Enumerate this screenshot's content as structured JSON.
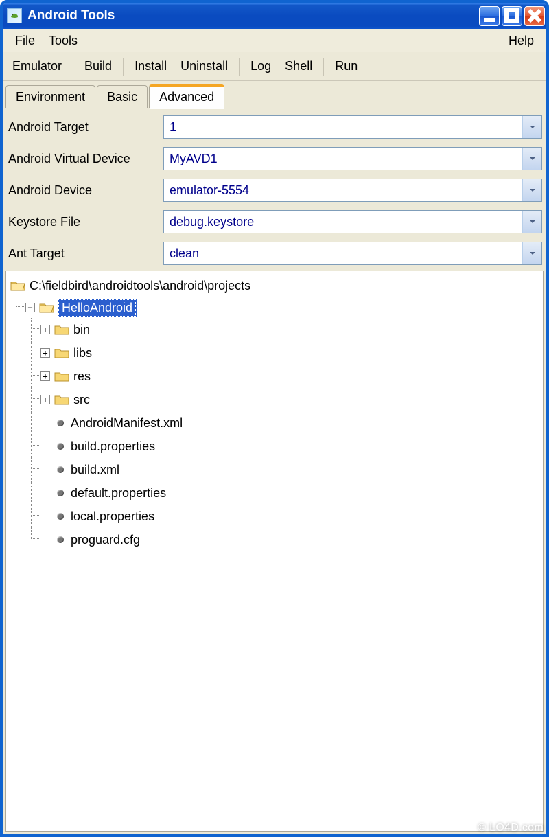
{
  "window": {
    "title": "Android Tools"
  },
  "menubar": {
    "file": "File",
    "tools": "Tools",
    "help": "Help"
  },
  "toolbar": {
    "emulator": "Emulator",
    "build": "Build",
    "install": "Install",
    "uninstall": "Uninstall",
    "log": "Log",
    "shell": "Shell",
    "run": "Run"
  },
  "tabs": {
    "environment": "Environment",
    "basic": "Basic",
    "advanced": "Advanced",
    "active": "advanced"
  },
  "form": {
    "androidTarget": {
      "label": "Android Target",
      "value": "1"
    },
    "androidVirtualDevice": {
      "label": "Android Virtual Device",
      "value": "MyAVD1"
    },
    "androidDevice": {
      "label": "Android Device",
      "value": "emulator-5554"
    },
    "keystoreFile": {
      "label": "Keystore File",
      "value": "debug.keystore"
    },
    "antTarget": {
      "label": "Ant Target",
      "value": "clean"
    }
  },
  "tree": {
    "root": "C:\\fieldbird\\androidtools\\android\\projects",
    "project": "HelloAndroid",
    "folders": [
      "bin",
      "libs",
      "res",
      "src"
    ],
    "files": [
      "AndroidManifest.xml",
      "build.properties",
      "build.xml",
      "default.properties",
      "local.properties",
      "proguard.cfg"
    ]
  },
  "watermark": "© LO4D.com"
}
